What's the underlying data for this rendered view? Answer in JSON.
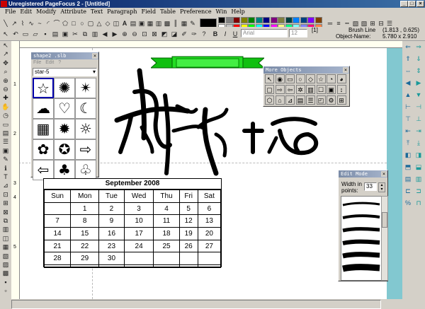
{
  "window": {
    "title": "Unregistered PageFocus 2 - [Untitled]"
  },
  "menu": [
    "File",
    "Edit",
    "Modify",
    "Attribute",
    "Text",
    "Paragraph",
    "Field",
    "Table",
    "Preference",
    "Win",
    "Help"
  ],
  "toolbar": {
    "font_name": "Arial",
    "font_size": "12",
    "brush_label": "Brush Line",
    "coords": "(1.813 , 0.625)",
    "object_name_label": "Object-Name:",
    "size_readout": "5.780 x 2.910",
    "page_index": "[1]"
  },
  "palette": [
    "#000000",
    "#808080",
    "#800000",
    "#808000",
    "#008000",
    "#008080",
    "#000080",
    "#800080",
    "#808040",
    "#004040",
    "#0080ff",
    "#004080",
    "#8000ff",
    "#804000",
    "#ffffff",
    "#c0c0c0",
    "#ff0000",
    "#ffff00",
    "#00ff00",
    "#00ffff",
    "#0000ff",
    "#ff00ff",
    "#ffff80",
    "#00ff80",
    "#80ffff",
    "#8080ff",
    "#ff0080",
    "#ff8040"
  ],
  "shape_panel": {
    "title": "shape2 .slb",
    "menu": [
      "File",
      "Edit",
      "?"
    ],
    "selected": "star-5",
    "shapes": [
      "star-5",
      "burst-16",
      "star-8",
      "cloud",
      "heart",
      "crescent",
      "grid",
      "burst",
      "sun",
      "flower",
      "seal",
      "right-arrow",
      "left-arrow",
      "tree",
      "leaf"
    ]
  },
  "more_objects_panel": {
    "title": "More Objects"
  },
  "edit_mode_panel": {
    "title": "Edit Mode",
    "width_label": "Width in points:",
    "width_value": "33"
  },
  "calendar": {
    "title": "September 2008",
    "days": [
      "Sun",
      "Mon",
      "Tue",
      "Wed",
      "Thu",
      "Fri",
      "Sat"
    ],
    "weeks": [
      [
        "",
        "1",
        "2",
        "3",
        "4",
        "5",
        "6"
      ],
      [
        "7",
        "8",
        "9",
        "10",
        "11",
        "12",
        "13"
      ],
      [
        "14",
        "15",
        "16",
        "17",
        "18",
        "19",
        "20"
      ],
      [
        "21",
        "22",
        "23",
        "24",
        "25",
        "26",
        "27"
      ],
      [
        "28",
        "29",
        "30",
        "",
        "",
        "",
        ""
      ],
      [
        "",
        "",
        "",
        "",
        "",
        "",
        ""
      ]
    ]
  },
  "ruler": {
    "marks": [
      "1",
      "2",
      "3",
      "4",
      "5"
    ]
  }
}
